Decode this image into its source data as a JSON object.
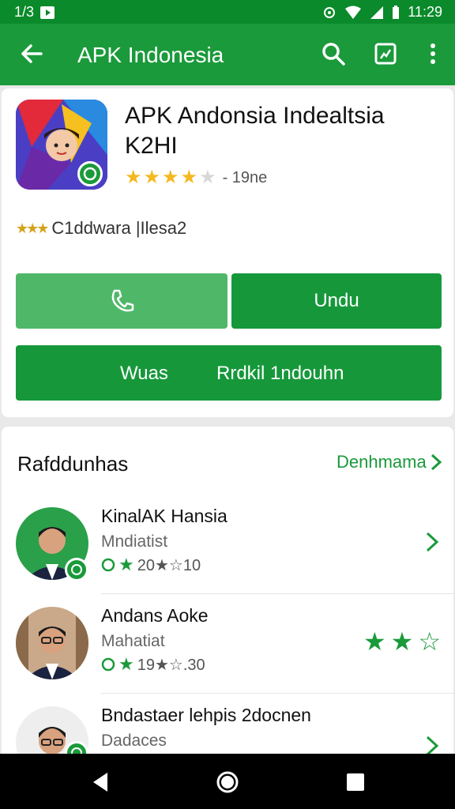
{
  "status_bar": {
    "left_text": "1/3",
    "time": "11:29"
  },
  "app_bar": {
    "title": "APK Indonesia"
  },
  "app": {
    "title": "APK Andonsia Indealtsia K2HI",
    "rating": 4,
    "rating_count": "- 19ne",
    "developer": "C1ddwara |Ilesa2"
  },
  "buttons": {
    "primary": "Undu",
    "wide_left": "Wuas",
    "wide_right": "Rrdkil  1ndouhn"
  },
  "section": {
    "title": "Rafddunhas",
    "see_more": "Denhmama"
  },
  "list": [
    {
      "name": "KinalAK  Hansia",
      "sub": "Mndiatist",
      "meta": "20★☆10"
    },
    {
      "name": "Andans Aoke",
      "sub": "Mahatiat",
      "meta": "19★☆.30"
    },
    {
      "name": "Bndastaer lehpis 2docnen",
      "sub": "Dadaces",
      "meta": ""
    }
  ],
  "colors": {
    "brand": "#1a9a3a",
    "brand_dark": "#0a8a2a",
    "star": "#f5b820"
  }
}
